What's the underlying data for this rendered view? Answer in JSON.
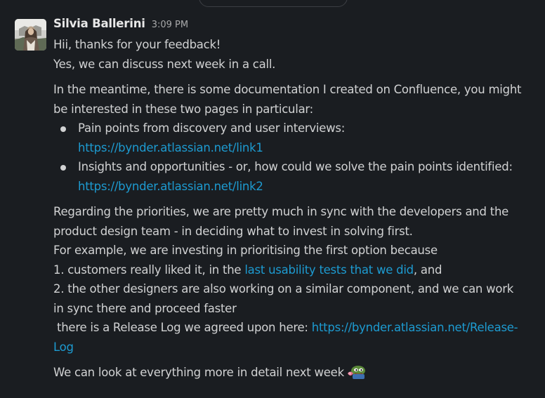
{
  "message": {
    "sender": "Silvia Ballerini",
    "timestamp": "3:09 PM",
    "paragraph1": [
      "Hii, thanks for your feedback!",
      "Yes, we can discuss next week in a call."
    ],
    "paragraph2": [
      "In the meantime, there is some documentation I created on Confluence, you might",
      "be interested in these two pages in particular:"
    ],
    "bullets": [
      {
        "text": "Pain points from discovery and user interviews:",
        "link": "https://bynder.atlassian.net/link1"
      },
      {
        "text": "Insights and opportunities - or, how could we solve the pain points identified:",
        "link": "https://bynder.atlassian.net/link2"
      }
    ],
    "paragraph3": {
      "line1": "Regarding the priorities, we are pretty much in sync with the developers and the",
      "line2": "product design team - in deciding what to invest in solving first.",
      "line3": "For example, we are investing in prioritising the first option because",
      "line4_pre": "1. customers really liked it, in the ",
      "line4_link": "last usability tests that we did",
      "line4_post": ", and",
      "line5": "2. the other designers are also working on a similar component, and we can work",
      "line6": "in sync there and proceed faster",
      "line7_pre": " there is a Release Log we agreed upon here: ",
      "line7_link_part1": "https://bynder.atlassian.net/Release-",
      "line7_link_part2": "Log"
    },
    "closing": "We can look at everything more in detail next week",
    "closing_emoji": "peepo-emoji"
  },
  "colors": {
    "background": "#1a1d21",
    "text": "#d1d2d3",
    "link": "#1d9bd1",
    "timestamp": "#a8a9aa"
  }
}
